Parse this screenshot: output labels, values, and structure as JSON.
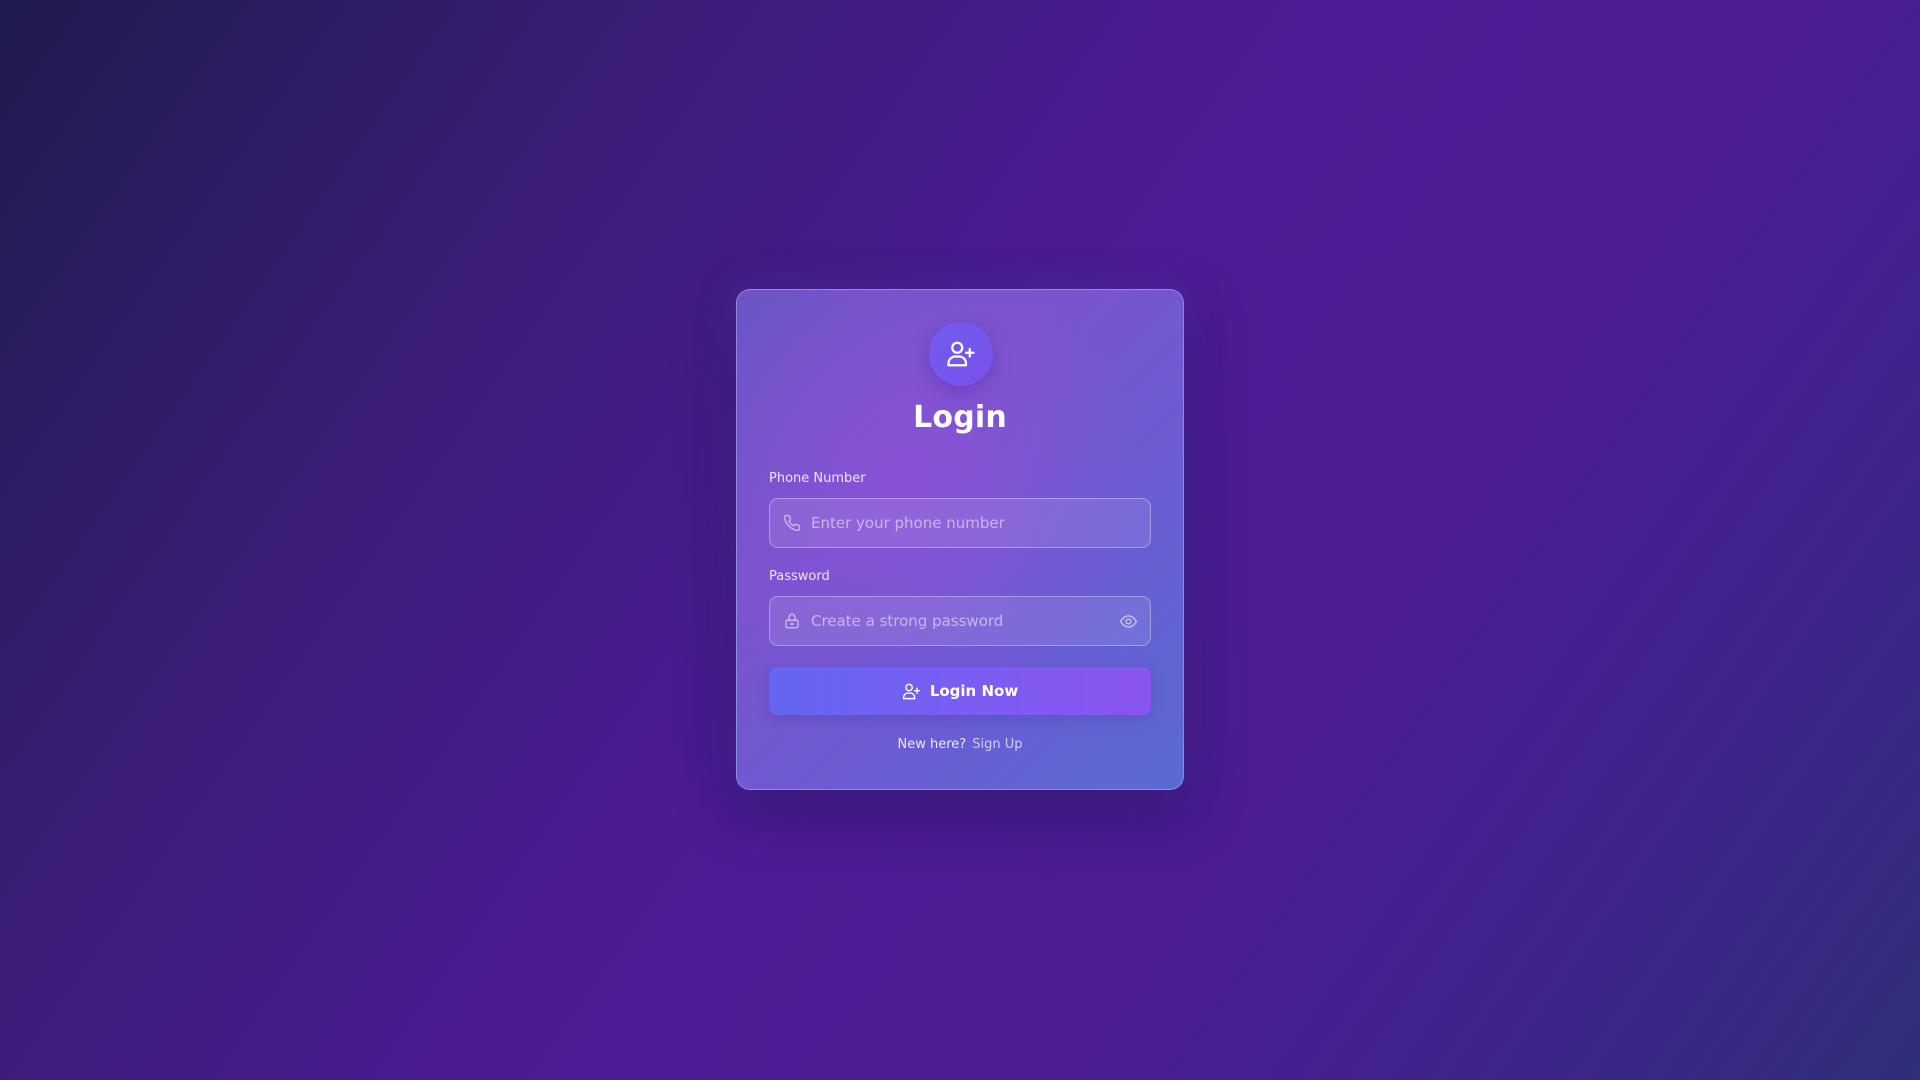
{
  "login": {
    "title": "Login",
    "phone": {
      "label": "Phone Number",
      "placeholder": "Enter your phone number",
      "icon": "phone-icon"
    },
    "password": {
      "label": "Password",
      "placeholder": "Create a strong password",
      "icon": "lock-icon",
      "toggle_icon": "eye-icon"
    },
    "submit_label": "Login Now",
    "footer": {
      "prompt": "New here?",
      "link_label": "Sign Up"
    }
  },
  "colors": {
    "background_start": "#1f1b4d",
    "background_mid": "#4c1c96",
    "card_accent": "#6c55c6",
    "button_start": "#6366f1",
    "button_end": "#8a55ee"
  }
}
